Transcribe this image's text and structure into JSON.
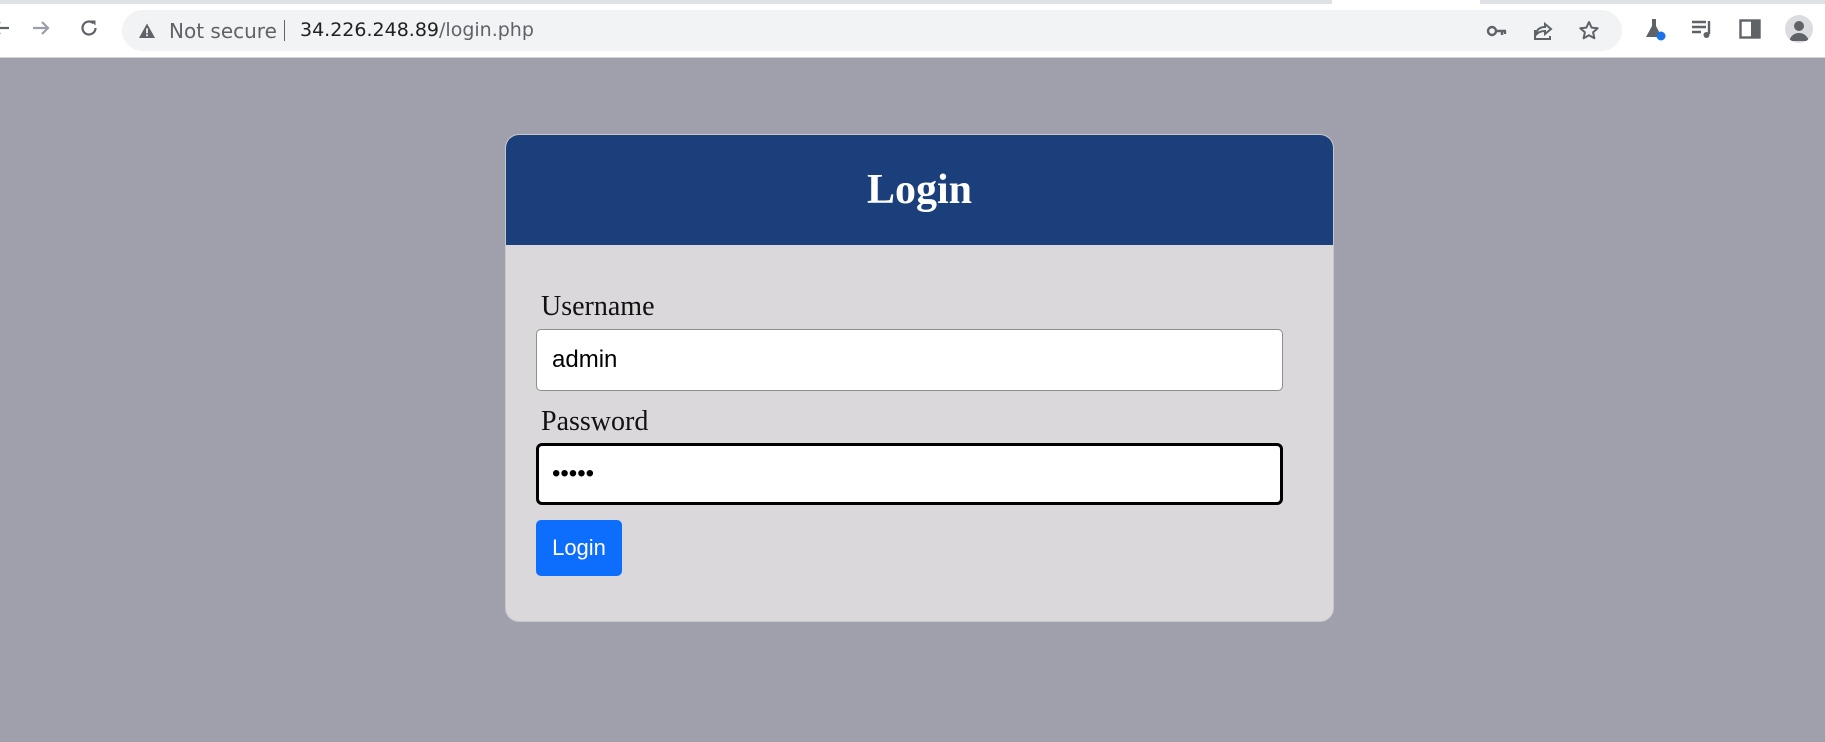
{
  "browser": {
    "security_label": "Not secure",
    "url_host": "34.226.248.89",
    "url_path": "/login.php",
    "icons": [
      "back-arrow-icon",
      "forward-arrow-icon",
      "reload-icon",
      "warning-icon",
      "key-icon",
      "share-icon",
      "star-icon",
      "labs-flask-icon",
      "reading-list-icon",
      "side-panel-icon",
      "profile-icon"
    ],
    "colors": {
      "toolbar": "#ffffff",
      "omnibox": "#f1f3f4",
      "icon": "#5f6368",
      "flask_dot": "#1a73e8"
    }
  },
  "page": {
    "background": "#a0a0ac"
  },
  "login_form": {
    "title": "Login",
    "username_label": "Username",
    "username_value": "admin",
    "password_label": "Password",
    "password_value": "•••••",
    "submit_label": "Login",
    "colors": {
      "header": "#1b3f7a",
      "card": "#dad8da",
      "button": "#0d6efd"
    }
  }
}
